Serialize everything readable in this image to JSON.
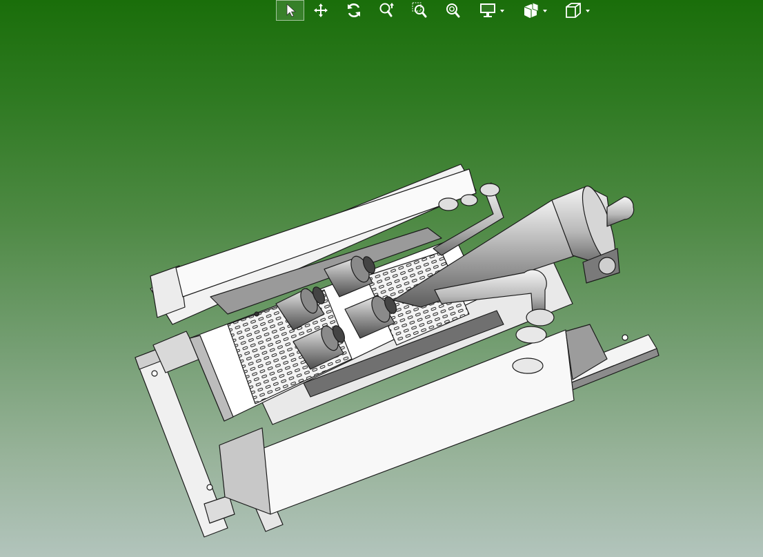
{
  "viewer": {
    "background_top": "#1a6e0a",
    "background_bottom": "#b2c4bc"
  },
  "toolbar": {
    "tools": [
      {
        "id": "select",
        "icon": "cursor-arrow-icon",
        "active": true
      },
      {
        "id": "pan",
        "icon": "pan-move-icon",
        "active": false
      },
      {
        "id": "rotate",
        "icon": "rotate-icon",
        "active": false
      },
      {
        "id": "zoom-in-out",
        "icon": "zoom-in-out-icon",
        "active": false
      },
      {
        "id": "zoom-window",
        "icon": "zoom-window-icon",
        "active": false
      },
      {
        "id": "zoom-fit",
        "icon": "zoom-fit-icon",
        "active": false
      },
      {
        "id": "display-mode",
        "icon": "display-monitor-icon",
        "dropdown": true
      },
      {
        "id": "section",
        "icon": "section-view-icon",
        "dropdown": true
      },
      {
        "id": "view-orientation",
        "icon": "view-cube-icon",
        "dropdown": true
      }
    ]
  }
}
